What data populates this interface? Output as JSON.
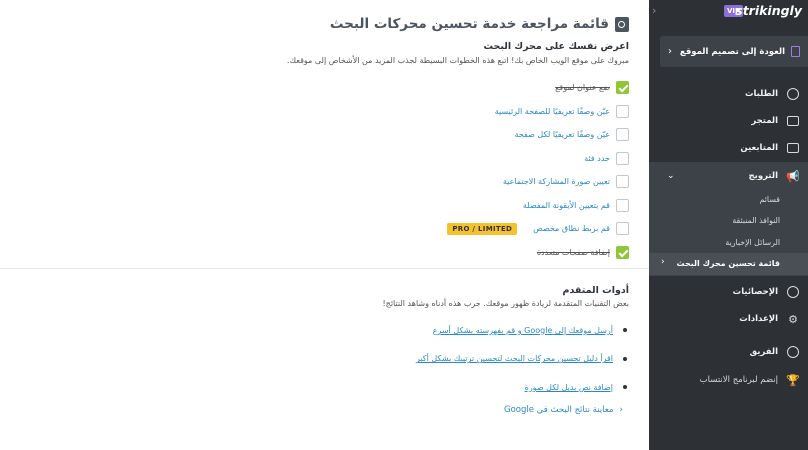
{
  "main": {
    "title": "قائمة مراجعة خدمة تحسين محركات البحث",
    "section1_title": "اعرض نفسك على محرك البحث",
    "section1_desc": "مبروك على موقع الويب الخاص بك! اتبع هذه الخطوات البسيطة لجذب المزيد من الأشخاص إلى موقعك.",
    "checklist": [
      {
        "label": "ضع عنوان لموقع",
        "done": true
      },
      {
        "label": "عيّن وصفًا تعريفيًا للصفحة الرئيسية",
        "done": false
      },
      {
        "label": "عيّن وصفًا تعريفيًا لكل صفحة",
        "done": false
      },
      {
        "label": "حدد فئة",
        "done": false
      },
      {
        "label": "تعيين صورة المشاركة الاجتماعية",
        "done": false
      },
      {
        "label": "قم بتعيين الأيقونة المفضلة",
        "done": false
      },
      {
        "label": "قم بربط نطاق مخصص",
        "done": false
      },
      {
        "label": "إضافة صفحات متعددة",
        "done": true
      }
    ],
    "pro_badge": "PRO / LIMITED",
    "section2_title": "أدوات المتقدم",
    "section2_desc": "بعض التقنيات المتقدمة لزيادة ظهور موقعك. جرب هذه أدناه وشاهد النتائج!",
    "advanced_links": [
      "أرسل موقعك إلى Google و قم بفهرسته بشكل أسرع",
      "اقرأ دليل تحسين محركات البحث لتحسين ترتيبك بشكل أكبر",
      "إضافة نص بديل لكل صورة"
    ],
    "preview_link": "معاينة نتائج البحث في Google",
    "preview_chevron": "‹"
  },
  "sidebar": {
    "brand": "strikingly",
    "vip": "VIP",
    "collapse_chevron": "‹",
    "back_label": "العودة إلى تصميم الموقع",
    "back_chevron": "‹",
    "orders": "الطلبات",
    "store": "المتجر",
    "followers": "المتابعين",
    "promotion": "الترويج",
    "promotion_chevron": "⌄",
    "sub_coupons": "قسائم",
    "sub_popups": "النوافذ المنبثقة",
    "sub_newsletters": "الرسائل الإخبارية",
    "sub_seo": "قائمة تحسين محرك البحث",
    "sub_seo_chevron": "‹",
    "analytics": "الإحصائيات",
    "settings": "الإعدادات",
    "team": "الفريق",
    "affiliate": "إنضم لبرنامج الانتساب"
  }
}
